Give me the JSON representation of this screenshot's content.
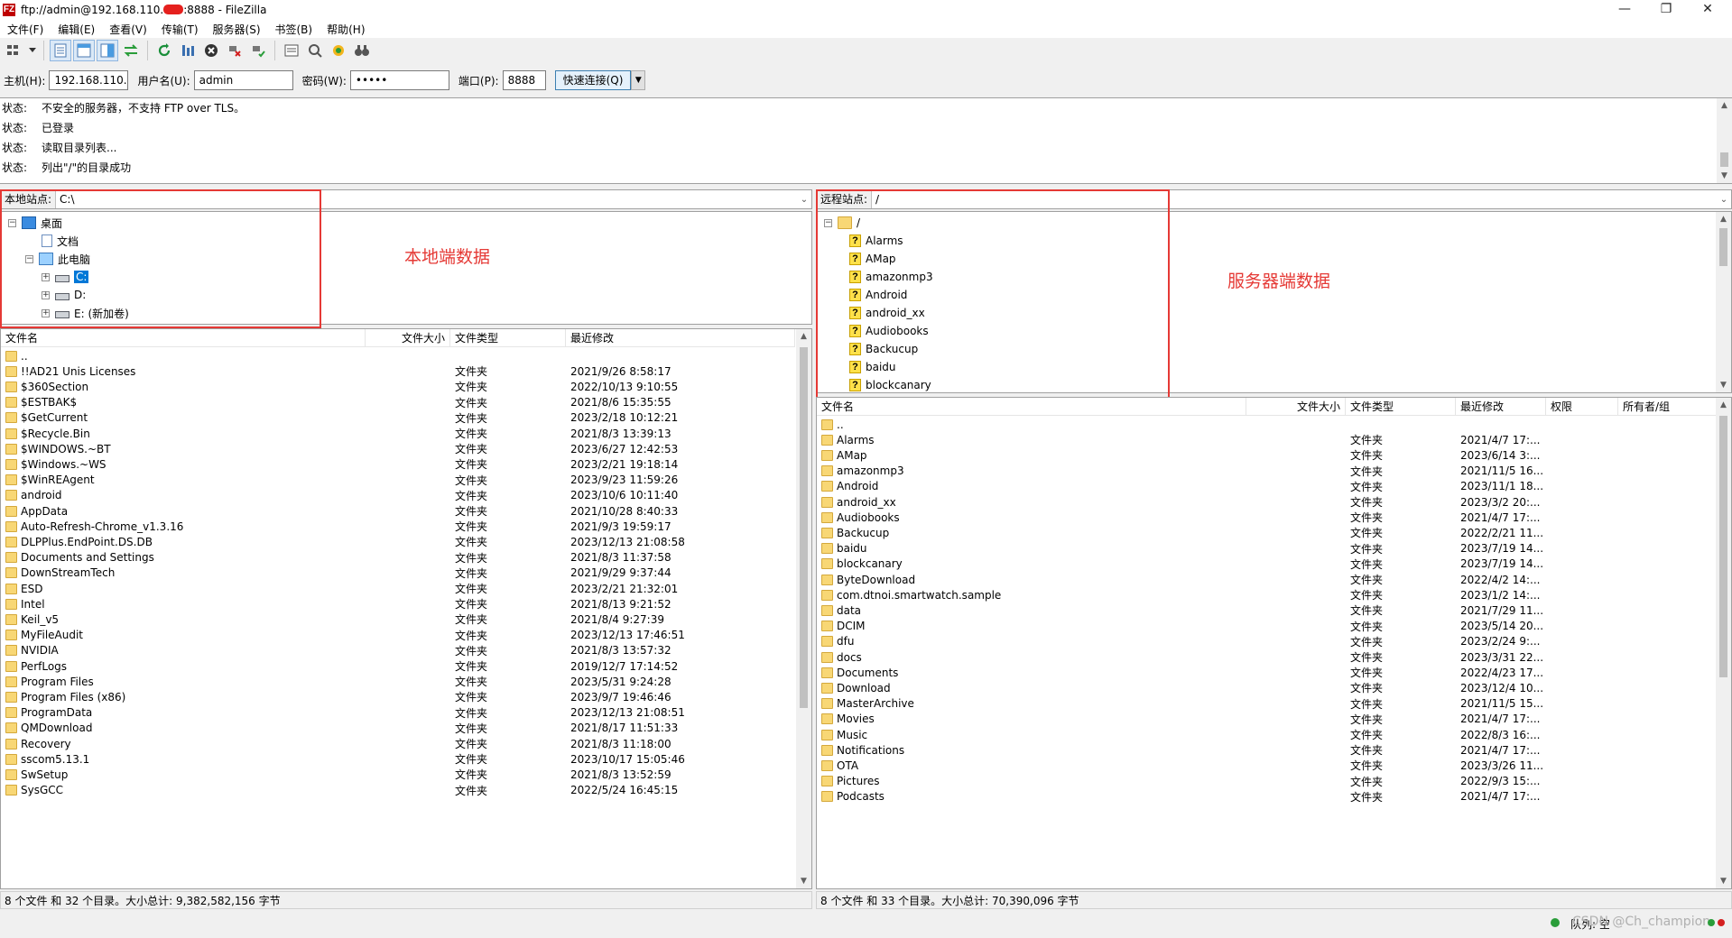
{
  "window": {
    "title_pre": "ftp://admin@192.168.110.",
    "title_post": ":8888 - FileZilla",
    "app_icon": "FZ"
  },
  "menu": [
    "文件(F)",
    "编辑(E)",
    "查看(V)",
    "传输(T)",
    "服务器(S)",
    "书签(B)",
    "帮助(H)"
  ],
  "quickconnect": {
    "host_label": "主机(H):",
    "host_value": "192.168.110.",
    "user_label": "用户名(U):",
    "user_value": "admin",
    "pass_label": "密码(W):",
    "pass_value": "•••••",
    "port_label": "端口(P):",
    "port_value": "8888",
    "connect_label": "快速连接(Q)"
  },
  "log": [
    {
      "k": "状态:",
      "v": "不安全的服务器，不支持 FTP over TLS。"
    },
    {
      "k": "状态:",
      "v": "已登录"
    },
    {
      "k": "状态:",
      "v": "读取目录列表..."
    },
    {
      "k": "状态:",
      "v": "列出\"/\"的目录成功"
    }
  ],
  "local": {
    "site_label": "本地站点:",
    "path": "C:\\",
    "tree": {
      "desktop": "桌面",
      "docs": "文档",
      "pc": "此电脑",
      "c": "C:",
      "d": "D:",
      "e": "E: (新加卷)"
    },
    "annotation": "本地端数据",
    "columns": {
      "name": "文件名",
      "size": "文件大小",
      "type": "文件类型",
      "modified": "最近修改"
    },
    "files": [
      {
        "name": "..",
        "type": "",
        "modified": ""
      },
      {
        "name": "!!AD21 Unis Licenses",
        "type": "文件夹",
        "modified": "2021/9/26 8:58:17"
      },
      {
        "name": "$360Section",
        "type": "文件夹",
        "modified": "2022/10/13 9:10:55"
      },
      {
        "name": "$ESTBAK$",
        "type": "文件夹",
        "modified": "2021/8/6 15:35:55"
      },
      {
        "name": "$GetCurrent",
        "type": "文件夹",
        "modified": "2023/2/18 10:12:21"
      },
      {
        "name": "$Recycle.Bin",
        "type": "文件夹",
        "modified": "2021/8/3 13:39:13"
      },
      {
        "name": "$WINDOWS.~BT",
        "type": "文件夹",
        "modified": "2023/6/27 12:42:53"
      },
      {
        "name": "$Windows.~WS",
        "type": "文件夹",
        "modified": "2023/2/21 19:18:14"
      },
      {
        "name": "$WinREAgent",
        "type": "文件夹",
        "modified": "2023/9/23 11:59:26"
      },
      {
        "name": "android",
        "type": "文件夹",
        "modified": "2023/10/6 10:11:40"
      },
      {
        "name": "AppData",
        "type": "文件夹",
        "modified": "2021/10/28 8:40:33"
      },
      {
        "name": "Auto-Refresh-Chrome_v1.3.16",
        "type": "文件夹",
        "modified": "2021/9/3 19:59:17"
      },
      {
        "name": "DLPPlus.EndPoint.DS.DB",
        "type": "文件夹",
        "modified": "2023/12/13 21:08:58"
      },
      {
        "name": "Documents and Settings",
        "type": "文件夹",
        "modified": "2021/8/3 11:37:58"
      },
      {
        "name": "DownStreamTech",
        "type": "文件夹",
        "modified": "2021/9/29 9:37:44"
      },
      {
        "name": "ESD",
        "type": "文件夹",
        "modified": "2023/2/21 21:32:01"
      },
      {
        "name": "Intel",
        "type": "文件夹",
        "modified": "2021/8/13 9:21:52"
      },
      {
        "name": "Keil_v5",
        "type": "文件夹",
        "modified": "2021/8/4 9:27:39"
      },
      {
        "name": "MyFileAudit",
        "type": "文件夹",
        "modified": "2023/12/13 17:46:51"
      },
      {
        "name": "NVIDIA",
        "type": "文件夹",
        "modified": "2021/8/3 13:57:32"
      },
      {
        "name": "PerfLogs",
        "type": "文件夹",
        "modified": "2019/12/7 17:14:52"
      },
      {
        "name": "Program Files",
        "type": "文件夹",
        "modified": "2023/5/31 9:24:28"
      },
      {
        "name": "Program Files (x86)",
        "type": "文件夹",
        "modified": "2023/9/7 19:46:46"
      },
      {
        "name": "ProgramData",
        "type": "文件夹",
        "modified": "2023/12/13 21:08:51"
      },
      {
        "name": "QMDownload",
        "type": "文件夹",
        "modified": "2021/8/17 11:51:33"
      },
      {
        "name": "Recovery",
        "type": "文件夹",
        "modified": "2021/8/3 11:18:00"
      },
      {
        "name": "sscom5.13.1",
        "type": "文件夹",
        "modified": "2023/10/17 15:05:46"
      },
      {
        "name": "SwSetup",
        "type": "文件夹",
        "modified": "2021/8/3 13:52:59"
      },
      {
        "name": "SysGCC",
        "type": "文件夹",
        "modified": "2022/5/24 16:45:15"
      }
    ],
    "status": "8 个文件 和 32 个目录。大小总计: 9,382,582,156 字节"
  },
  "remote": {
    "site_label": "远程站点:",
    "path": "/",
    "tree_root": "/",
    "tree": [
      "Alarms",
      "AMap",
      "amazonmp3",
      "Android",
      "android_xx",
      "Audiobooks",
      "Backucup",
      "baidu",
      "blockcanary"
    ],
    "annotation": "服务器端数据",
    "columns": {
      "name": "文件名",
      "size": "文件大小",
      "type": "文件类型",
      "modified": "最近修改",
      "perm": "权限",
      "owner": "所有者/组"
    },
    "files": [
      {
        "name": "..",
        "type": "",
        "modified": ""
      },
      {
        "name": "Alarms",
        "type": "文件夹",
        "modified": "2021/4/7 17:..."
      },
      {
        "name": "AMap",
        "type": "文件夹",
        "modified": "2023/6/14 3:..."
      },
      {
        "name": "amazonmp3",
        "type": "文件夹",
        "modified": "2021/11/5 16..."
      },
      {
        "name": "Android",
        "type": "文件夹",
        "modified": "2023/11/1 18..."
      },
      {
        "name": "android_xx",
        "type": "文件夹",
        "modified": "2023/3/2 20:..."
      },
      {
        "name": "Audiobooks",
        "type": "文件夹",
        "modified": "2021/4/7 17:..."
      },
      {
        "name": "Backucup",
        "type": "文件夹",
        "modified": "2022/2/21 11..."
      },
      {
        "name": "baidu",
        "type": "文件夹",
        "modified": "2023/7/19 14..."
      },
      {
        "name": "blockcanary",
        "type": "文件夹",
        "modified": "2023/7/19 14..."
      },
      {
        "name": "ByteDownload",
        "type": "文件夹",
        "modified": "2022/4/2 14:..."
      },
      {
        "name": "com.dtnoi.smartwatch.sample",
        "type": "文件夹",
        "modified": "2023/1/2 14:..."
      },
      {
        "name": "data",
        "type": "文件夹",
        "modified": "2021/7/29 11..."
      },
      {
        "name": "DCIM",
        "type": "文件夹",
        "modified": "2023/5/14 20..."
      },
      {
        "name": "dfu",
        "type": "文件夹",
        "modified": "2023/2/24 9:..."
      },
      {
        "name": "docs",
        "type": "文件夹",
        "modified": "2023/3/31 22..."
      },
      {
        "name": "Documents",
        "type": "文件夹",
        "modified": "2022/4/23 17..."
      },
      {
        "name": "Download",
        "type": "文件夹",
        "modified": "2023/12/4 10..."
      },
      {
        "name": "MasterArchive",
        "type": "文件夹",
        "modified": "2021/11/5 15..."
      },
      {
        "name": "Movies",
        "type": "文件夹",
        "modified": "2021/4/7 17:..."
      },
      {
        "name": "Music",
        "type": "文件夹",
        "modified": "2022/8/3 16:..."
      },
      {
        "name": "Notifications",
        "type": "文件夹",
        "modified": "2021/4/7 17:..."
      },
      {
        "name": "OTA",
        "type": "文件夹",
        "modified": "2023/3/26 11..."
      },
      {
        "name": "Pictures",
        "type": "文件夹",
        "modified": "2022/9/3 15:..."
      },
      {
        "name": "Podcasts",
        "type": "文件夹",
        "modified": "2021/4/7 17:..."
      }
    ],
    "status": "8 个文件 和 33 个目录。大小总计: 70,390,096 字节"
  },
  "bottom": {
    "queue": "队列: 空",
    "watermark": "CSDN @Ch_champion"
  }
}
